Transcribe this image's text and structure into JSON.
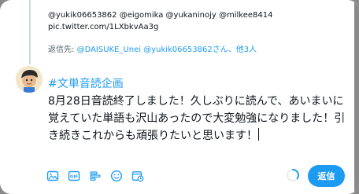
{
  "quoted_tweet": {
    "mentions": "@yukik06653862 @eigomika @yukaninojy @milkee8414",
    "link": "pic.twitter.com/1LXbkvAa3g"
  },
  "reply_to": {
    "prefix": "返信先: ",
    "users": "@DAISUKE_Unei @yukik06653862さん、他3人"
  },
  "compose": {
    "hashtag": "#文単音読企画",
    "text": "8月28日音読終了しました！久しぶりに読んで、あいまいに覚えていた単語も沢山あったので大変勉強になりました！引き続きこれからも頑張りたいと思います！"
  },
  "toolbar": {
    "icons": [
      "image-icon",
      "gif-icon",
      "poll-icon",
      "emoji-icon",
      "schedule-icon"
    ],
    "progress": 0.35,
    "reply_label": "返信"
  },
  "colors": {
    "accent": "#1d9bf0",
    "text": "#0f1419",
    "muted": "#536471"
  }
}
